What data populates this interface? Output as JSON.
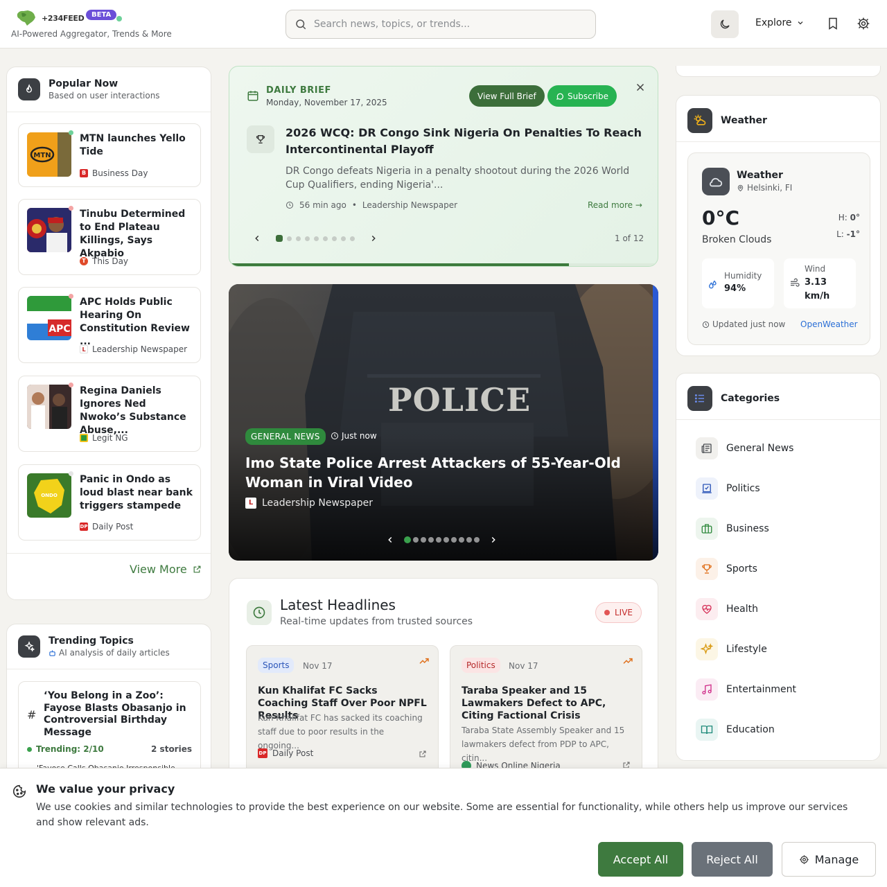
{
  "header": {
    "logo_text": "+234FEED",
    "beta": "BETA",
    "tagline": "AI-Powered Aggregator, Trends & More",
    "search_placeholder": "Search news, topics, or trends...",
    "explore": "Explore"
  },
  "popular": {
    "title": "Popular Now",
    "subtitle": "Based on user interactions",
    "items": [
      {
        "title": "MTN launches Yello Tide",
        "source": "Business Day"
      },
      {
        "title": "Tinubu Determined to End Plateau Killings, Says Akpabio",
        "source": "This Day"
      },
      {
        "title": "APC Holds Public Hearing On Constitution Review ...",
        "source": "Leadership Newspaper"
      },
      {
        "title": "Regina Daniels Ignores Ned Nwoko’s Substance Abuse,...",
        "source": "Legit NG"
      },
      {
        "title": "Panic in Ondo as loud blast near bank triggers stampede",
        "source": "Daily Post"
      }
    ],
    "view_more": "View More"
  },
  "trending": {
    "title": "Trending Topics",
    "subtitle": "AI analysis of daily articles",
    "item_title": "‘You Belong in a Zoo’: Fayose Blasts Obasanjo in Controversial Birthday Message",
    "item_rank": "Trending: 2/10",
    "item_count": "2 stories",
    "item_next": "'Fayose Calls Obasanjo Irresponsible..."
  },
  "brief": {
    "label": "DAILY BRIEF",
    "date": "Monday, November 17, 2025",
    "view_full": "View Full Brief",
    "subscribe": "Subscribe",
    "title": "2026 WCQ: DR Congo Sink Nigeria On Penalties To Reach Intercontinental Playoff",
    "desc": "DR Congo defeats Nigeria in a penalty shootout during the 2026 World Cup Qualifiers, ending Nigeria'...",
    "time": "56 min ago",
    "sep": "•",
    "source": "Leadership Newspaper",
    "read_more": "Read more →",
    "counter": "1 of 12",
    "progress": 0.79
  },
  "hero": {
    "sign": "POLICE",
    "tag": "GENERAL NEWS",
    "time": "Just now",
    "title": "Imo State Police Arrest Attackers of 55-Year-Old Woman in Viral Video",
    "source": "Leadership Newspaper"
  },
  "latest": {
    "title": "Latest Headlines",
    "subtitle": "Real-time updates from trusted sources",
    "live": "LIVE",
    "cards": [
      {
        "category": "Sports",
        "date": "Nov 17",
        "title": "Kun Khalifat FC Sacks Coaching Staff Over Poor NPFL Results",
        "desc": "Kun Khalifat FC has sacked its coaching staff due to poor results in the ongoing...",
        "source": "Daily Post"
      },
      {
        "category": "Politics",
        "date": "Nov 17",
        "title": "Taraba Speaker and 15 Lawmakers Defect to APC, Citing Factional Crisis",
        "desc": "Taraba State Assembly Speaker and 15 lawmakers defect from PDP to APC, citin...",
        "source": "News Online Nigeria"
      }
    ]
  },
  "weather": {
    "section_title": "Weather",
    "title": "Weather",
    "location": "Helsinki, FI",
    "temp": "0°C",
    "condition": "Broken Clouds",
    "hi_label": "H:",
    "hi": "0°",
    "lo_label": "L:",
    "lo": "-1°",
    "humidity_label": "Humidity",
    "humidity": "94%",
    "wind_label": "Wind",
    "wind": "3.13 km/h",
    "updated": "Updated just now",
    "provider": "OpenWeather"
  },
  "categories": {
    "title": "Categories",
    "items": [
      {
        "label": "General News",
        "color": "#4a4d52"
      },
      {
        "label": "Politics",
        "color": "#2b55b8"
      },
      {
        "label": "Business",
        "color": "#2f8a3d"
      },
      {
        "label": "Sports",
        "color": "#e0701c"
      },
      {
        "label": "Health",
        "color": "#d6335a"
      },
      {
        "label": "Lifestyle",
        "color": "#d99a12"
      },
      {
        "label": "Entertainment",
        "color": "#d02f8a"
      },
      {
        "label": "Education",
        "color": "#1f8a7a"
      }
    ]
  },
  "cookie": {
    "title": "We value your privacy",
    "text": "We use cookies and similar technologies to provide the best experience on our website. Some are essential for functionality, while others help us improve our services and show relevant ads.",
    "accept": "Accept All",
    "reject": "Reject All",
    "manage": "Manage"
  }
}
